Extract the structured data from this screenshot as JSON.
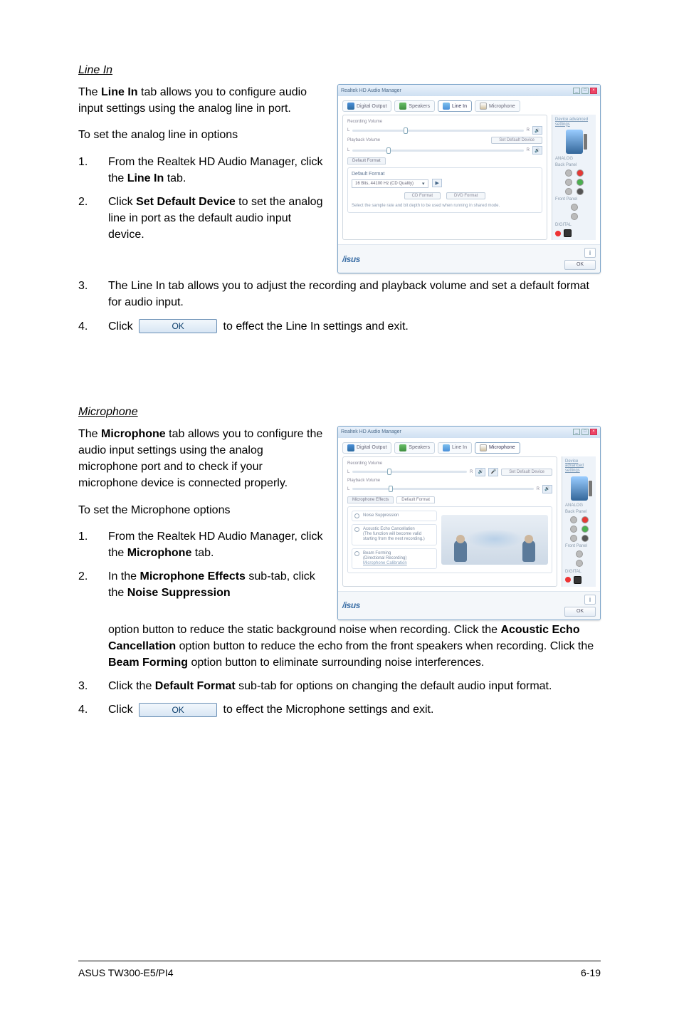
{
  "line_in": {
    "title": "Line In",
    "intro_part1": "The ",
    "intro_bold": "Line In",
    "intro_part2": " tab allows you to configure audio input settings using the analog line in port.",
    "subhead": "To set the analog line in options",
    "steps": {
      "s1_a": "From the Realtek HD Audio Manager, click the ",
      "s1_b": "Line In",
      "s1_c": " tab.",
      "s2_a": "Click ",
      "s2_b": "Set Default Device",
      "s2_c": " to set the analog line in port as the default audio input device.",
      "s3": "The Line In tab allows you to adjust the recording and playback volume and set a default format for audio input.",
      "s4_a": "Click ",
      "s4_b": " to effect the Line In settings and exit."
    }
  },
  "microphone": {
    "title": "Microphone",
    "intro_a": "The ",
    "intro_b": "Microphone",
    "intro_c": " tab allows you to configure the audio input settings using the analog microphone port and to check if your microphone device is connected properly.",
    "subhead": "To set the Microphone options",
    "steps": {
      "s1_a": "From the Realtek HD Audio Manager, click the ",
      "s1_b": "Microphone",
      "s1_c": " tab.",
      "s2_a": "In the ",
      "s2_b": "Microphone Effects",
      "s2_c": " sub-tab, click the ",
      "s2_d": "Noise Suppression",
      "s2_e": " option button to reduce the static background noise when recording. Click the ",
      "s2_f": "Acoustic Echo Cancellation",
      "s2_g": " option button to reduce the echo from the front speakers when recording. Click the ",
      "s2_h": "Beam Forming",
      "s2_i": " option button to eliminate surrounding noise interferences.",
      "s3_a": "Click the ",
      "s3_b": "Default Format",
      "s3_c": " sub-tab for options on changing the default audio input format.",
      "s4_a": "Click ",
      "s4_b": " to effect the Microphone settings and exit."
    }
  },
  "ok_label": "OK",
  "screenshot_common": {
    "window_title": "Realtek HD Audio Manager",
    "tabs": {
      "digital": "Digital Output",
      "speakers": "Speakers",
      "line_in": "Line In",
      "microphone": "Microphone"
    },
    "right": {
      "advanced": "Device advanced settings",
      "analog": "ANALOG",
      "back_panel": "Back Panel",
      "front_panel": "Front Panel",
      "digital": "DIGITAL"
    },
    "recording_label": "Recording Volume",
    "playback_label": "Playback Volume",
    "set_default": "Set Default Device",
    "ok": "OK",
    "asus": "/isus"
  },
  "screenshot_linein": {
    "subtab": "Default Format",
    "panel_title": "Default Format",
    "combo": "16 Bits, 44100 Hz (CD Quality)",
    "cd_btn": "CD Format",
    "dvd_btn": "DVD Format",
    "hint": "Select the sample rate and bit depth to be used when running in shared mode."
  },
  "screenshot_mic": {
    "subtab_effects": "Microphone Effects",
    "subtab_default": "Default Format",
    "opt_noise": "Noise Suppression",
    "opt_echo_title": "Acoustic Echo Cancellation",
    "opt_echo_desc": "(The function will become valid starting from the next recording.)",
    "opt_beam_title": "Beam Forming",
    "opt_beam_sub": "(Directional Recording)",
    "calib_link": "Microphone Calibration"
  },
  "footer": {
    "left": "ASUS TW300-E5/PI4",
    "right": "6-19"
  }
}
